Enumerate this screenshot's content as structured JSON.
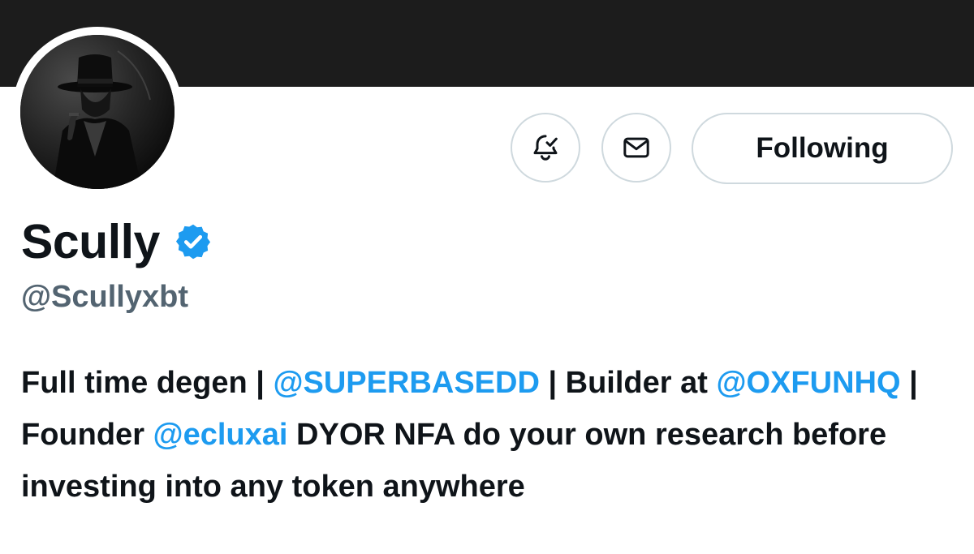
{
  "profile": {
    "display_name": "Scully",
    "verified_icon": "verified-badge-icon",
    "handle": "@Scullyxbt"
  },
  "actions": {
    "notifications_icon": "bell-check-icon",
    "message_icon": "mail-icon",
    "follow_label": "Following"
  },
  "bio": {
    "part1": "Full time degen | ",
    "mention1": "@SUPERBASEDD",
    "part2": " | Builder at ",
    "mention2": "@OXFUNHQ",
    "part3": " | Founder ",
    "mention3": "@ecluxai",
    "part4": " DYOR NFA do your own research before investing into any token anywhere"
  },
  "colors": {
    "banner": "#1c1c1c",
    "text": "#0f1419",
    "secondary_text": "#536471",
    "link": "#1d9bf0",
    "border": "#cfd9de",
    "verified": "#1d9bf0"
  }
}
